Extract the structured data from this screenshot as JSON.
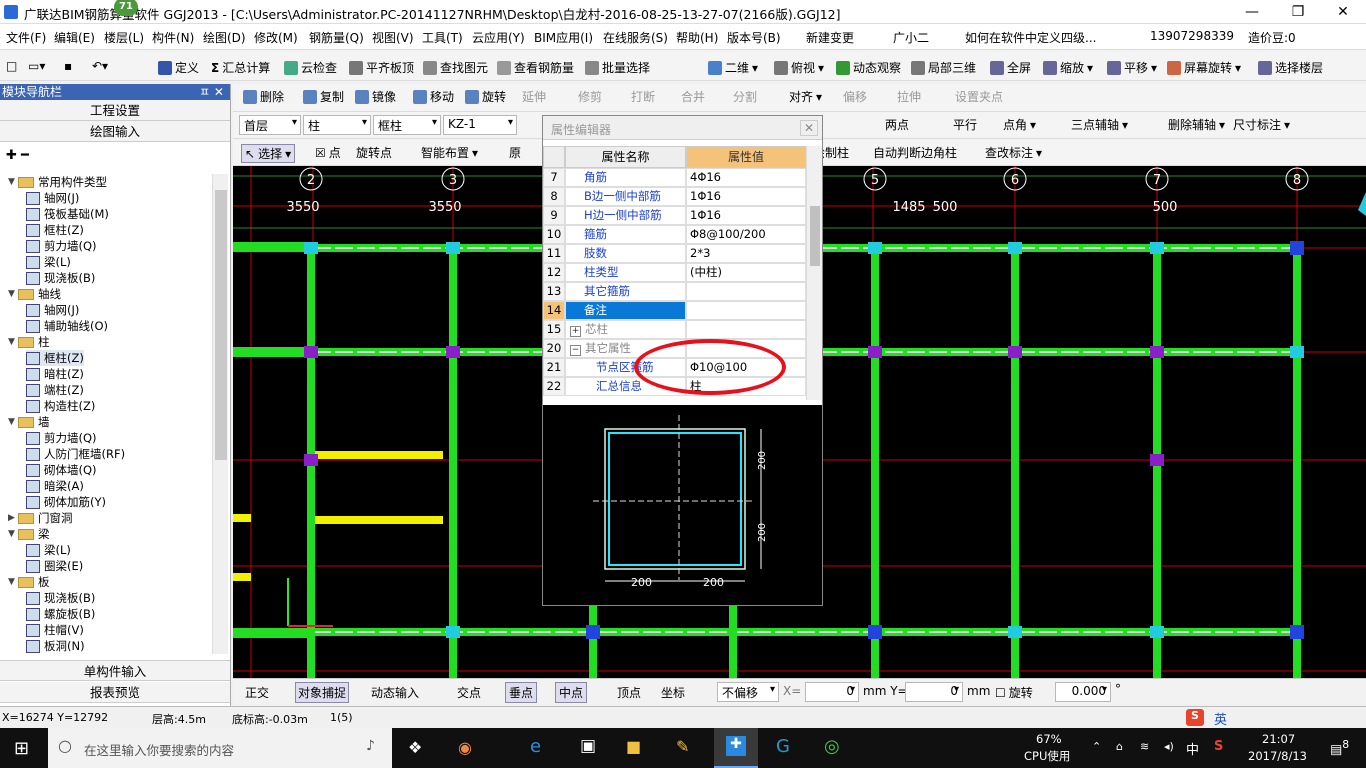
{
  "titlebar": {
    "app_title": "广联达BIM钢筋算量软件 GGJ2013 - [C:\\Users\\Administrator.PC-20141127NRHM\\Desktop\\白龙村-2016-08-25-13-27-07(2166版).GGJ12]",
    "badge": "71",
    "min": "—",
    "max": "❐",
    "close": "✕"
  },
  "menu": [
    "文件(F)",
    "编辑(E)",
    "楼层(L)",
    "构件(N)",
    "绘图(D)",
    "修改(M)",
    "钢筋量(Q)",
    "视图(V)",
    "工具(T)",
    "云应用(Y)",
    "BIM应用(I)",
    "在线服务(S)",
    "帮助(H)",
    "版本号(B)",
    "新建变更",
    "广小二",
    "如何在软件中定义四级...",
    "13907298339",
    "造价豆:0"
  ],
  "toolbar1": [
    "定义",
    "汇总计算",
    "云检查",
    "平齐板顶",
    "查找图元",
    "查看钢筋量",
    "批量选择",
    "二维",
    "俯视",
    "动态观察",
    "局部三维",
    "全屏",
    "缩放",
    "平移",
    "屏幕旋转",
    "选择楼层"
  ],
  "toolbar2": [
    "删除",
    "复制",
    "镜像",
    "移动",
    "旋转",
    "延伸",
    "修剪",
    "打断",
    "合并",
    "分割",
    "对齐",
    "偏移",
    "拉伸",
    "设置夹点"
  ],
  "toolbar3": {
    "floor": "首层",
    "type": "柱",
    "subtype": "框柱",
    "name": "KZ-1",
    "extra": [
      "两点",
      "平行",
      "点角",
      "三点辅轴",
      "删除辅轴",
      "尺寸标注"
    ]
  },
  "toolbar4": [
    "选择",
    "点",
    "旋转点",
    "智能布置",
    "原",
    "绘制柱",
    "自动判断边角柱",
    "查改标注"
  ],
  "nav": {
    "header": "模块导航栏",
    "pin": "ㅍ ✕",
    "btn1": "工程设置",
    "btn2": "绘图输入",
    "btn3": "单构件输入",
    "btn4": "报表预览",
    "tree": [
      {
        "lvl": 0,
        "t": "常用构件类型",
        "g": "▼",
        "f": 1
      },
      {
        "lvl": 1,
        "t": "轴网(J)"
      },
      {
        "lvl": 1,
        "t": "筏板基础(M)"
      },
      {
        "lvl": 1,
        "t": "框柱(Z)"
      },
      {
        "lvl": 1,
        "t": "剪力墙(Q)"
      },
      {
        "lvl": 1,
        "t": "梁(L)"
      },
      {
        "lvl": 1,
        "t": "现浇板(B)"
      },
      {
        "lvl": 0,
        "t": "轴线",
        "g": "▼",
        "f": 1
      },
      {
        "lvl": 1,
        "t": "轴网(J)"
      },
      {
        "lvl": 1,
        "t": "辅助轴线(O)"
      },
      {
        "lvl": 0,
        "t": "柱",
        "g": "▼",
        "f": 1
      },
      {
        "lvl": 1,
        "t": "框柱(Z)",
        "sel": 1
      },
      {
        "lvl": 1,
        "t": "暗柱(Z)"
      },
      {
        "lvl": 1,
        "t": "端柱(Z)"
      },
      {
        "lvl": 1,
        "t": "构造柱(Z)"
      },
      {
        "lvl": 0,
        "t": "墙",
        "g": "▼",
        "f": 1
      },
      {
        "lvl": 1,
        "t": "剪力墙(Q)"
      },
      {
        "lvl": 1,
        "t": "人防门框墙(RF)"
      },
      {
        "lvl": 1,
        "t": "砌体墙(Q)"
      },
      {
        "lvl": 1,
        "t": "暗梁(A)"
      },
      {
        "lvl": 1,
        "t": "砌体加筋(Y)"
      },
      {
        "lvl": 0,
        "t": "门窗洞",
        "g": "▶",
        "f": 1
      },
      {
        "lvl": 0,
        "t": "梁",
        "g": "▼",
        "f": 1
      },
      {
        "lvl": 1,
        "t": "梁(L)"
      },
      {
        "lvl": 1,
        "t": "圈梁(E)"
      },
      {
        "lvl": 0,
        "t": "板",
        "g": "▼",
        "f": 1
      },
      {
        "lvl": 1,
        "t": "现浇板(B)"
      },
      {
        "lvl": 1,
        "t": "螺旋板(B)"
      },
      {
        "lvl": 1,
        "t": "柱帽(V)"
      },
      {
        "lvl": 1,
        "t": "板洞(N)"
      }
    ]
  },
  "prop": {
    "title": "属性编辑器",
    "col_name": "属性名称",
    "col_val": "属性值",
    "rows": [
      {
        "n": "7",
        "k": "角筋",
        "v": "4Φ16"
      },
      {
        "n": "8",
        "k": "B边一侧中部筋",
        "v": "1Φ16"
      },
      {
        "n": "9",
        "k": "H边一侧中部筋",
        "v": "1Φ16"
      },
      {
        "n": "10",
        "k": "箍筋",
        "v": "Φ8@100/200"
      },
      {
        "n": "11",
        "k": "肢数",
        "v": "2*3"
      },
      {
        "n": "12",
        "k": "柱类型",
        "v": "(中柱)"
      },
      {
        "n": "13",
        "k": "其它箍筋",
        "v": ""
      },
      {
        "n": "14",
        "k": "备注",
        "v": "",
        "sel": 1
      },
      {
        "n": "15",
        "k": "芯柱",
        "v": "",
        "g": "+"
      },
      {
        "n": "20",
        "k": "其它属性",
        "v": "",
        "g": "−"
      },
      {
        "n": "21",
        "k": "节点区箍筋",
        "v": "Φ10@100",
        "sub": 1
      },
      {
        "n": "22",
        "k": "汇总信息",
        "v": "柱",
        "sub": 1
      }
    ],
    "dim_left": "200",
    "dim_bottom": "200",
    "dim_right_top": "200",
    "dim_right_bottom": "200"
  },
  "axes": {
    "labels": [
      "2",
      "3",
      "5",
      "6",
      "7",
      "8"
    ],
    "dims": [
      "3550",
      "3550",
      "1485",
      "500",
      "500"
    ]
  },
  "bottombar": {
    "items": [
      "正交",
      "对象捕捉",
      "动态输入",
      "交点",
      "垂点",
      "中点",
      "顶点",
      "坐标",
      "不偏移"
    ],
    "x_label": "X=",
    "x_val": "0",
    "y_label": "mm Y=",
    "y_val": "0",
    "mm": "mm",
    "rot_label": "旋转",
    "rot_val": "0.000",
    "deg": "°"
  },
  "status": {
    "coord": "X=16274 Y=12792",
    "floor_h": "层高:4.5m",
    "base_h": "底标高:-0.03m",
    "count": "1(5)"
  },
  "taskbar": {
    "search": "在这里输入你要搜索的内容",
    "cpu": "67%",
    "cpu_label": "CPU使用",
    "ime": "中",
    "time": "21:07",
    "date": "2017/8/13",
    "notif": "8",
    "ime_en": "英"
  },
  "colors": {
    "canvas": "#000000",
    "beam": "#22dd22",
    "wall": "#d6d6d6",
    "grid": "#cc0000",
    "axis": "#2a8a2a",
    "col_cyan": "#22cce0",
    "col_purple": "#8a1ec8",
    "col_blue": "#2244dd",
    "yellow": "#f0f000"
  }
}
